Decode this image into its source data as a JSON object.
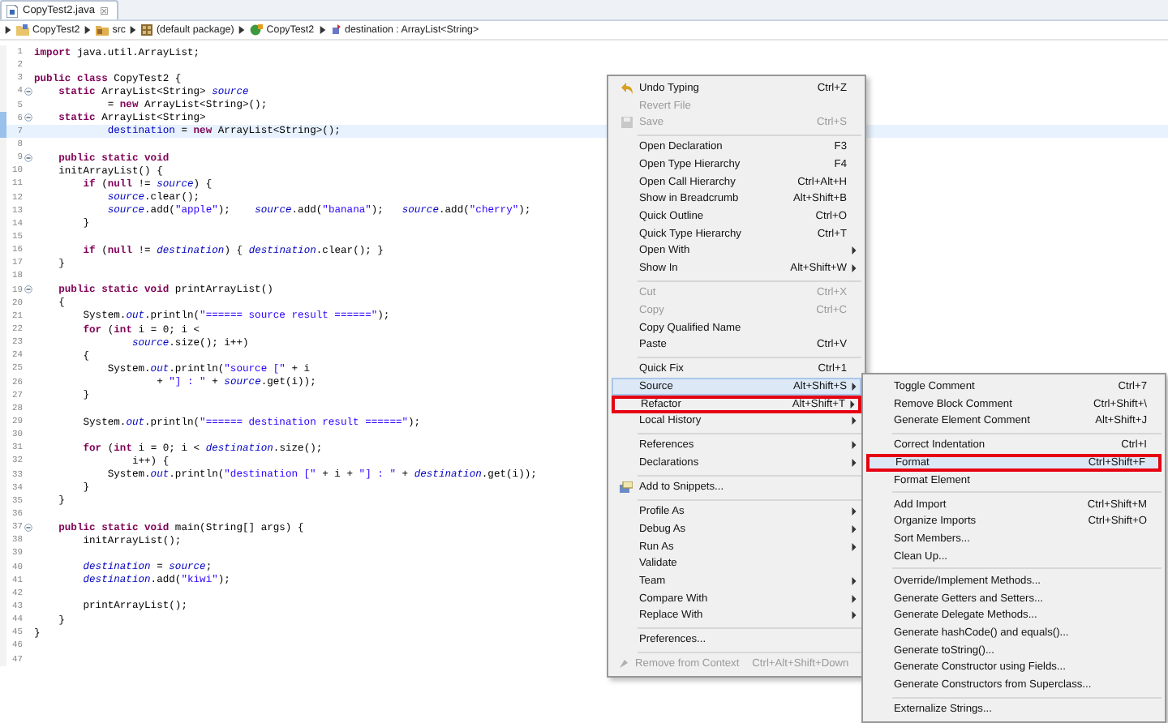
{
  "tab": {
    "title": "CopyTest2.java",
    "close": "☒",
    "selected": true
  },
  "breadcrumb": [
    {
      "label": "CopyTest2"
    },
    {
      "label": "src"
    },
    {
      "label": "(default package)"
    },
    {
      "label": "CopyTest2"
    },
    {
      "label": "destination : ArrayList<String>"
    }
  ],
  "code_lines": [
    {
      "n": "1",
      "fold": false,
      "current": false,
      "changed": false,
      "segs": [
        {
          "kind": "kw",
          "text": "import"
        },
        {
          "kind": "p",
          "text": " java.util.ArrayList;"
        }
      ]
    },
    {
      "n": "2",
      "fold": false,
      "current": false,
      "changed": false
    },
    {
      "n": "3",
      "fold": false,
      "current": false,
      "changed": false,
      "segs": [
        {
          "kind": "kw",
          "text": "public class"
        },
        {
          "kind": "p",
          "text": " CopyTest2 {"
        }
      ]
    },
    {
      "n": "4",
      "fold": true,
      "current": false,
      "changed": false,
      "segs": [
        {
          "kind": "kw",
          "text": "    static"
        },
        {
          "kind": "p",
          "text": " ArrayList<String> "
        },
        {
          "kind": "sf",
          "text": "source"
        }
      ]
    },
    {
      "n": "5",
      "fold": false,
      "current": false,
      "changed": false,
      "segs": [
        {
          "kind": "p",
          "text": "            = "
        },
        {
          "kind": "kw",
          "text": "new"
        },
        {
          "kind": "p",
          "text": " ArrayList<String>();"
        }
      ]
    },
    {
      "n": "6",
      "fold": true,
      "current": false,
      "changed": true,
      "segs": [
        {
          "kind": "kw",
          "text": "    static"
        },
        {
          "kind": "p",
          "text": " ArrayList<String>"
        }
      ]
    },
    {
      "n": "7",
      "fold": false,
      "current": true,
      "changed": true,
      "segs": [
        {
          "kind": "f",
          "text": "            destination"
        },
        {
          "kind": "p",
          "text": " = "
        },
        {
          "kind": "kw",
          "text": "new"
        },
        {
          "kind": "p",
          "text": " ArrayList<String>();"
        }
      ]
    },
    {
      "n": "8",
      "fold": false,
      "current": false,
      "changed": false
    },
    {
      "n": "9",
      "fold": true,
      "current": false,
      "changed": false,
      "segs": [
        {
          "kind": "kw",
          "text": "    public static void"
        }
      ]
    },
    {
      "n": "10",
      "fold": false,
      "current": false,
      "changed": false,
      "segs": [
        {
          "kind": "p",
          "text": "    initArrayList() {"
        }
      ]
    },
    {
      "n": "11",
      "fold": false,
      "current": false,
      "changed": false,
      "segs": [
        {
          "kind": "kw",
          "text": "        if"
        },
        {
          "kind": "p",
          "text": " ("
        },
        {
          "kind": "kw",
          "text": "null"
        },
        {
          "kind": "p",
          "text": " != "
        },
        {
          "kind": "sf",
          "text": "source"
        },
        {
          "kind": "p",
          "text": ") {"
        }
      ]
    },
    {
      "n": "12",
      "fold": false,
      "current": false,
      "changed": false,
      "segs": [
        {
          "kind": "sf",
          "text": "            source"
        },
        {
          "kind": "p",
          "text": ".clear();"
        }
      ]
    },
    {
      "n": "13",
      "fold": false,
      "current": false,
      "changed": false,
      "segs": [
        {
          "kind": "sf",
          "text": "            source"
        },
        {
          "kind": "p",
          "text": ".add("
        },
        {
          "kind": "s",
          "text": "\"apple\""
        },
        {
          "kind": "p",
          "text": ");    "
        },
        {
          "kind": "sf",
          "text": "source"
        },
        {
          "kind": "p",
          "text": ".add("
        },
        {
          "kind": "s",
          "text": "\"banana\""
        },
        {
          "kind": "p",
          "text": ");   "
        },
        {
          "kind": "sf",
          "text": "source"
        },
        {
          "kind": "p",
          "text": ".add("
        },
        {
          "kind": "s",
          "text": "\"cherry\""
        },
        {
          "kind": "p",
          "text": ");"
        }
      ]
    },
    {
      "n": "14",
      "fold": false,
      "current": false,
      "changed": false,
      "segs": [
        {
          "kind": "p",
          "text": "        }"
        }
      ]
    },
    {
      "n": "15",
      "fold": false,
      "current": false,
      "changed": false
    },
    {
      "n": "16",
      "fold": false,
      "current": false,
      "changed": false,
      "segs": [
        {
          "kind": "kw",
          "text": "        if"
        },
        {
          "kind": "p",
          "text": " ("
        },
        {
          "kind": "kw",
          "text": "null"
        },
        {
          "kind": "p",
          "text": " != "
        },
        {
          "kind": "sf",
          "text": "destination"
        },
        {
          "kind": "p",
          "text": ") { "
        },
        {
          "kind": "sf",
          "text": "destination"
        },
        {
          "kind": "p",
          "text": ".clear(); }"
        }
      ]
    },
    {
      "n": "17",
      "fold": false,
      "current": false,
      "changed": false,
      "segs": [
        {
          "kind": "p",
          "text": "    }"
        }
      ]
    },
    {
      "n": "18",
      "fold": false,
      "current": false,
      "changed": false
    },
    {
      "n": "19",
      "fold": true,
      "current": false,
      "changed": false,
      "segs": [
        {
          "kind": "kw",
          "text": "    public static void"
        },
        {
          "kind": "p",
          "text": " printArrayList()"
        }
      ]
    },
    {
      "n": "20",
      "fold": false,
      "current": false,
      "changed": false,
      "segs": [
        {
          "kind": "p",
          "text": "    {"
        }
      ]
    },
    {
      "n": "21",
      "fold": false,
      "current": false,
      "changed": false,
      "segs": [
        {
          "kind": "p",
          "text": "        System."
        },
        {
          "kind": "sf",
          "text": "out"
        },
        {
          "kind": "p",
          "text": ".println("
        },
        {
          "kind": "s",
          "text": "\"====== source result ======\""
        },
        {
          "kind": "p",
          "text": ");"
        }
      ]
    },
    {
      "n": "22",
      "fold": false,
      "current": false,
      "changed": false,
      "segs": [
        {
          "kind": "kw",
          "text": "        for"
        },
        {
          "kind": "p",
          "text": " ("
        },
        {
          "kind": "kw",
          "text": "int"
        },
        {
          "kind": "p",
          "text": " i = 0; i <"
        }
      ]
    },
    {
      "n": "23",
      "fold": false,
      "current": false,
      "changed": false,
      "segs": [
        {
          "kind": "sf",
          "text": "                source"
        },
        {
          "kind": "p",
          "text": ".size(); i++)"
        }
      ]
    },
    {
      "n": "24",
      "fold": false,
      "current": false,
      "changed": false,
      "segs": [
        {
          "kind": "p",
          "text": "        {"
        }
      ]
    },
    {
      "n": "25",
      "fold": false,
      "current": false,
      "changed": false,
      "segs": [
        {
          "kind": "p",
          "text": "            System."
        },
        {
          "kind": "sf",
          "text": "out"
        },
        {
          "kind": "p",
          "text": ".println("
        },
        {
          "kind": "s",
          "text": "\"source [\""
        },
        {
          "kind": "p",
          "text": " + i"
        }
      ]
    },
    {
      "n": "26",
      "fold": false,
      "current": false,
      "changed": false,
      "segs": [
        {
          "kind": "p",
          "text": "                    + "
        },
        {
          "kind": "s",
          "text": "\"] : \""
        },
        {
          "kind": "p",
          "text": " + "
        },
        {
          "kind": "sf",
          "text": "source"
        },
        {
          "kind": "p",
          "text": ".get(i));"
        }
      ]
    },
    {
      "n": "27",
      "fold": false,
      "current": false,
      "changed": false,
      "segs": [
        {
          "kind": "p",
          "text": "        }"
        }
      ]
    },
    {
      "n": "28",
      "fold": false,
      "current": false,
      "changed": false
    },
    {
      "n": "29",
      "fold": false,
      "current": false,
      "changed": false,
      "segs": [
        {
          "kind": "p",
          "text": "        System."
        },
        {
          "kind": "sf",
          "text": "out"
        },
        {
          "kind": "p",
          "text": ".println("
        },
        {
          "kind": "s",
          "text": "\"====== destination result ======\""
        },
        {
          "kind": "p",
          "text": ");"
        }
      ]
    },
    {
      "n": "30",
      "fold": false,
      "current": false,
      "changed": false
    },
    {
      "n": "31",
      "fold": false,
      "current": false,
      "changed": false,
      "segs": [
        {
          "kind": "kw",
          "text": "        for"
        },
        {
          "kind": "p",
          "text": " ("
        },
        {
          "kind": "kw",
          "text": "int"
        },
        {
          "kind": "p",
          "text": " i = 0; i < "
        },
        {
          "kind": "sf",
          "text": "destination"
        },
        {
          "kind": "p",
          "text": ".size();"
        }
      ]
    },
    {
      "n": "32",
      "fold": false,
      "current": false,
      "changed": false,
      "segs": [
        {
          "kind": "p",
          "text": "                i++) {"
        }
      ]
    },
    {
      "n": "33",
      "fold": false,
      "current": false,
      "changed": false,
      "segs": [
        {
          "kind": "p",
          "text": "            System."
        },
        {
          "kind": "sf",
          "text": "out"
        },
        {
          "kind": "p",
          "text": ".println("
        },
        {
          "kind": "s",
          "text": "\"destination [\""
        },
        {
          "kind": "p",
          "text": " + i + "
        },
        {
          "kind": "s",
          "text": "\"] : \""
        },
        {
          "kind": "p",
          "text": " + "
        },
        {
          "kind": "sf",
          "text": "destination"
        },
        {
          "kind": "p",
          "text": ".get(i));"
        }
      ]
    },
    {
      "n": "34",
      "fold": false,
      "current": false,
      "changed": false,
      "segs": [
        {
          "kind": "p",
          "text": "        }"
        }
      ]
    },
    {
      "n": "35",
      "fold": false,
      "current": false,
      "changed": false,
      "segs": [
        {
          "kind": "p",
          "text": "    }"
        }
      ]
    },
    {
      "n": "36",
      "fold": false,
      "current": false,
      "changed": false
    },
    {
      "n": "37",
      "fold": true,
      "current": false,
      "changed": false,
      "segs": [
        {
          "kind": "kw",
          "text": "    public static void"
        },
        {
          "kind": "p",
          "text": " main(String[] args) {"
        }
      ]
    },
    {
      "n": "38",
      "fold": false,
      "current": false,
      "changed": false,
      "segs": [
        {
          "kind": "p",
          "text": "        initArrayList();"
        }
      ]
    },
    {
      "n": "39",
      "fold": false,
      "current": false,
      "changed": false
    },
    {
      "n": "40",
      "fold": false,
      "current": false,
      "changed": false,
      "segs": [
        {
          "kind": "sf",
          "text": "        destination"
        },
        {
          "kind": "p",
          "text": " = "
        },
        {
          "kind": "sf",
          "text": "source"
        },
        {
          "kind": "p",
          "text": ";"
        }
      ]
    },
    {
      "n": "41",
      "fold": false,
      "current": false,
      "changed": false,
      "segs": [
        {
          "kind": "sf",
          "text": "        destination"
        },
        {
          "kind": "p",
          "text": ".add("
        },
        {
          "kind": "s",
          "text": "\"kiwi\""
        },
        {
          "kind": "p",
          "text": ");"
        }
      ]
    },
    {
      "n": "42",
      "fold": false,
      "current": false,
      "changed": false
    },
    {
      "n": "43",
      "fold": false,
      "current": false,
      "changed": false,
      "segs": [
        {
          "kind": "p",
          "text": "        printArrayList();"
        }
      ]
    },
    {
      "n": "44",
      "fold": false,
      "current": false,
      "changed": false,
      "segs": [
        {
          "kind": "p",
          "text": "    }"
        }
      ]
    },
    {
      "n": "45",
      "fold": false,
      "current": false,
      "changed": false,
      "segs": [
        {
          "kind": "p",
          "text": "}"
        }
      ]
    },
    {
      "n": "46",
      "fold": false,
      "current": false,
      "changed": false
    },
    {
      "n": "47",
      "fold": false,
      "current": false,
      "changed": false
    }
  ],
  "context_menu": {
    "items": [
      {
        "kind": "item",
        "label": "Undo Typing",
        "shortcut": "Ctrl+Z",
        "disabled": false,
        "submenu": false,
        "selected": false,
        "outlined": false
      },
      {
        "kind": "item",
        "label": "Revert File",
        "disabled": true,
        "submenu": false,
        "selected": false,
        "outlined": false
      },
      {
        "kind": "item",
        "label": "Save",
        "shortcut": "Ctrl+S",
        "disabled": true,
        "submenu": false,
        "selected": false,
        "outlined": false
      },
      {
        "kind": "separator"
      },
      {
        "kind": "item",
        "label": "Open Declaration",
        "shortcut": "F3",
        "disabled": false,
        "submenu": false,
        "selected": false,
        "outlined": false
      },
      {
        "kind": "item",
        "label": "Open Type Hierarchy",
        "shortcut": "F4",
        "disabled": false,
        "submenu": false,
        "selected": false,
        "outlined": false
      },
      {
        "kind": "item",
        "label": "Open Call Hierarchy",
        "shortcut": "Ctrl+Alt+H",
        "disabled": false,
        "submenu": false,
        "selected": false,
        "outlined": false
      },
      {
        "kind": "item",
        "label": "Show in Breadcrumb",
        "shortcut": "Alt+Shift+B",
        "disabled": false,
        "submenu": false,
        "selected": false,
        "outlined": false
      },
      {
        "kind": "item",
        "label": "Quick Outline",
        "shortcut": "Ctrl+O",
        "disabled": false,
        "submenu": false,
        "selected": false,
        "outlined": false
      },
      {
        "kind": "item",
        "label": "Quick Type Hierarchy",
        "shortcut": "Ctrl+T",
        "disabled": false,
        "submenu": false,
        "selected": false,
        "outlined": false
      },
      {
        "kind": "item",
        "label": "Open With",
        "disabled": false,
        "submenu": true,
        "selected": false,
        "outlined": false
      },
      {
        "kind": "item",
        "label": "Show In",
        "shortcut": "Alt+Shift+W",
        "disabled": false,
        "submenu": true,
        "selected": false,
        "outlined": false
      },
      {
        "kind": "separator"
      },
      {
        "kind": "item",
        "label": "Cut",
        "shortcut": "Ctrl+X",
        "disabled": true,
        "submenu": false,
        "selected": false,
        "outlined": false
      },
      {
        "kind": "item",
        "label": "Copy",
        "shortcut": "Ctrl+C",
        "disabled": true,
        "submenu": false,
        "selected": false,
        "outlined": false
      },
      {
        "kind": "item",
        "label": "Copy Qualified Name",
        "disabled": false,
        "submenu": false,
        "selected": false,
        "outlined": false
      },
      {
        "kind": "item",
        "label": "Paste",
        "shortcut": "Ctrl+V",
        "disabled": false,
        "submenu": false,
        "selected": false,
        "outlined": false
      },
      {
        "kind": "separator"
      },
      {
        "kind": "item",
        "label": "Quick Fix",
        "shortcut": "Ctrl+1",
        "disabled": false,
        "submenu": false,
        "selected": false,
        "outlined": false
      },
      {
        "kind": "item",
        "label": "Source",
        "shortcut": "Alt+Shift+S",
        "disabled": false,
        "submenu": true,
        "selected": true,
        "outlined": false
      },
      {
        "kind": "item",
        "label": "Refactor",
        "shortcut": "Alt+Shift+T",
        "disabled": false,
        "submenu": true,
        "selected": false,
        "outlined": true
      },
      {
        "kind": "item",
        "label": "Local History",
        "disabled": false,
        "submenu": true,
        "selected": false,
        "outlined": false
      },
      {
        "kind": "separator"
      },
      {
        "kind": "item",
        "label": "References",
        "disabled": false,
        "submenu": true,
        "selected": false,
        "outlined": false
      },
      {
        "kind": "item",
        "label": "Declarations",
        "disabled": false,
        "submenu": true,
        "selected": false,
        "outlined": false
      },
      {
        "kind": "separator"
      },
      {
        "kind": "item",
        "label": "Add to Snippets...",
        "disabled": false,
        "submenu": false,
        "selected": false,
        "outlined": false
      },
      {
        "kind": "separator"
      },
      {
        "kind": "item",
        "label": "Profile As",
        "disabled": false,
        "submenu": true,
        "selected": false,
        "outlined": false
      },
      {
        "kind": "item",
        "label": "Debug As",
        "disabled": false,
        "submenu": true,
        "selected": false,
        "outlined": false
      },
      {
        "kind": "item",
        "label": "Run As",
        "disabled": false,
        "submenu": true,
        "selected": false,
        "outlined": false
      },
      {
        "kind": "item",
        "label": "Validate",
        "disabled": false,
        "submenu": false,
        "selected": false,
        "outlined": false
      },
      {
        "kind": "item",
        "label": "Team",
        "disabled": false,
        "submenu": true,
        "selected": false,
        "outlined": false
      },
      {
        "kind": "item",
        "label": "Compare With",
        "disabled": false,
        "submenu": true,
        "selected": false,
        "outlined": false
      },
      {
        "kind": "item",
        "label": "Replace With",
        "disabled": false,
        "submenu": true,
        "selected": false,
        "outlined": false
      },
      {
        "kind": "separator"
      },
      {
        "kind": "item",
        "label": "Preferences...",
        "disabled": false,
        "submenu": false,
        "selected": false,
        "outlined": false
      },
      {
        "kind": "separator"
      },
      {
        "kind": "item",
        "label": "Remove from Context",
        "shortcut": "Ctrl+Alt+Shift+Down",
        "disabled": true,
        "submenu": false,
        "selected": false,
        "outlined": false
      }
    ]
  },
  "source_submenu": {
    "items": [
      {
        "kind": "item",
        "label": "Toggle Comment",
        "shortcut": "Ctrl+7",
        "selected": false,
        "outlined": false
      },
      {
        "kind": "item",
        "label": "Remove Block Comment",
        "shortcut": "Ctrl+Shift+\\",
        "selected": false,
        "outlined": false
      },
      {
        "kind": "item",
        "label": "Generate Element Comment",
        "shortcut": "Alt+Shift+J",
        "selected": false,
        "outlined": false
      },
      {
        "kind": "separator"
      },
      {
        "kind": "item",
        "label": "Correct Indentation",
        "shortcut": "Ctrl+I",
        "selected": false,
        "outlined": false
      },
      {
        "kind": "item",
        "label": "Format",
        "shortcut": "Ctrl+Shift+F",
        "selected": true,
        "outlined": true
      },
      {
        "kind": "item",
        "label": "Format Element",
        "selected": false,
        "outlined": false
      },
      {
        "kind": "separator"
      },
      {
        "kind": "item",
        "label": "Add Import",
        "shortcut": "Ctrl+Shift+M",
        "selected": false,
        "outlined": false
      },
      {
        "kind": "item",
        "label": "Organize Imports",
        "shortcut": "Ctrl+Shift+O",
        "selected": false,
        "outlined": false
      },
      {
        "kind": "item",
        "label": "Sort Members...",
        "selected": false,
        "outlined": false
      },
      {
        "kind": "item",
        "label": "Clean Up...",
        "selected": false,
        "outlined": false
      },
      {
        "kind": "separator"
      },
      {
        "kind": "item",
        "label": "Override/Implement Methods...",
        "selected": false,
        "outlined": false
      },
      {
        "kind": "item",
        "label": "Generate Getters and Setters...",
        "selected": false,
        "outlined": false
      },
      {
        "kind": "item",
        "label": "Generate Delegate Methods...",
        "selected": false,
        "outlined": false
      },
      {
        "kind": "item",
        "label": "Generate hashCode() and equals()...",
        "selected": false,
        "outlined": false
      },
      {
        "kind": "item",
        "label": "Generate toString()...",
        "selected": false,
        "outlined": false
      },
      {
        "kind": "item",
        "label": "Generate Constructor using Fields...",
        "selected": false,
        "outlined": false
      },
      {
        "kind": "item",
        "label": "Generate Constructors from Superclass...",
        "selected": false,
        "outlined": false
      },
      {
        "kind": "separator"
      },
      {
        "kind": "item",
        "label": "Externalize Strings...",
        "selected": false,
        "outlined": false
      }
    ]
  }
}
